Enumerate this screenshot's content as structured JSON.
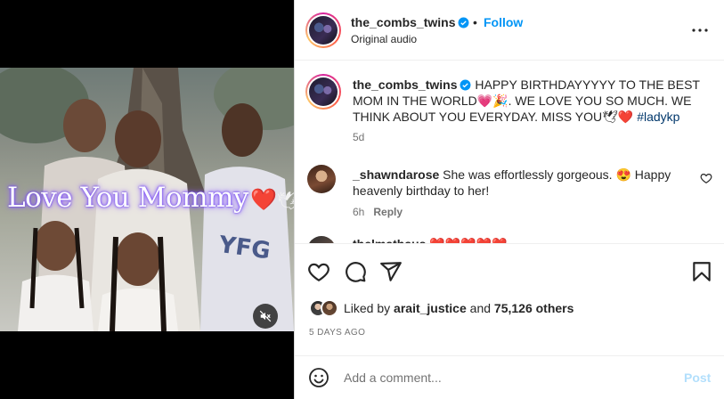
{
  "post": {
    "username": "the_combs_twins",
    "separator": "•",
    "follow_label": "Follow",
    "audio": "Original audio"
  },
  "media": {
    "overlay_text": "Love You Mommy",
    "overlay_heart": "❤️",
    "overlay_dove": "🕊"
  },
  "caption": {
    "username": "the_combs_twins",
    "text": "HAPPY BIRTHDAYYYYY TO THE BEST MOM IN THE WORLD💗🎉. WE LOVE YOU SO MUCH. WE THINK ABOUT YOU EVERYDAY. MISS YOU🕊❤️",
    "hashtag": "#ladykp",
    "time": "5d"
  },
  "comments": [
    {
      "username": "_shawndarose",
      "text": "She was effortlessly gorgeous. 😍 Happy heavenly birthday to her!",
      "time": "6h",
      "reply_label": "Reply"
    },
    {
      "username": "thelmathaus",
      "text": "❤️❤️❤️❤️❤️"
    }
  ],
  "likes": {
    "prefix": "Liked by",
    "user": "arait_justice",
    "joiner": "and",
    "others": "75,126 others"
  },
  "date": "5 DAYS AGO",
  "add_comment": {
    "placeholder": "Add a comment...",
    "post_label": "Post"
  },
  "colors": {
    "link_blue": "#0095f6",
    "post_disabled": "#b2dffc",
    "hashtag": "#00376b",
    "verified": "#0095f6"
  },
  "icons": [
    "verified-badge-icon",
    "more-options-icon",
    "mute-icon",
    "heart-icon",
    "comment-icon",
    "share-icon",
    "bookmark-icon",
    "emoji-icon"
  ]
}
